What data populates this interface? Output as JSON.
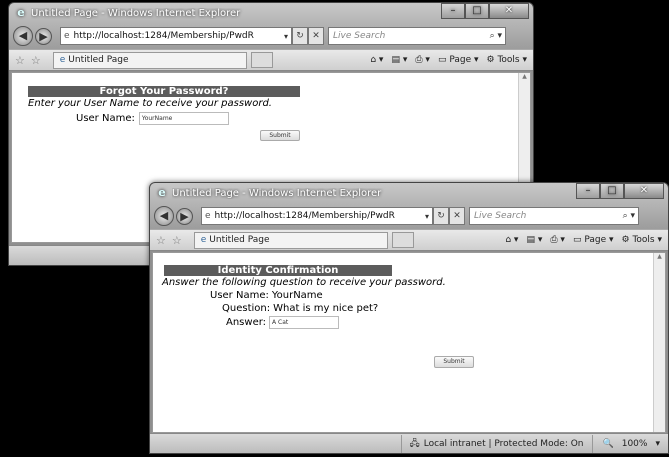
{
  "window1": {
    "title": "Untitled Page - Windows Internet Explorer",
    "address": "http://localhost:1284/Membership/PwdR",
    "search_placeholder": "Live Search",
    "tab_label": "Untitled Page",
    "page_menu": "Page",
    "tools_menu": "Tools",
    "form": {
      "heading": "Forgot Your Password?",
      "instruction": "Enter your User Name to receive your password.",
      "username_label": "User Name:",
      "username_value": "YourName",
      "submit_label": "Submit"
    }
  },
  "window2": {
    "title": "Untitled Page - Windows Internet Explorer",
    "address": "http://localhost:1284/Membership/PwdR",
    "search_placeholder": "Live Search",
    "tab_label": "Untitled Page",
    "page_menu": "Page",
    "tools_menu": "Tools",
    "form": {
      "heading": "Identity Confirmation",
      "instruction": "Answer the following question to receive your password.",
      "username_label": "User Name:",
      "username_value": "YourName",
      "question_label": "Question:",
      "question_value": "What is my nice pet?",
      "answer_label": "Answer:",
      "answer_value": "A Cat",
      "submit_label": "Submit"
    },
    "status": {
      "zone": "Local intranet | Protected Mode: On",
      "zoom": "100%"
    }
  }
}
